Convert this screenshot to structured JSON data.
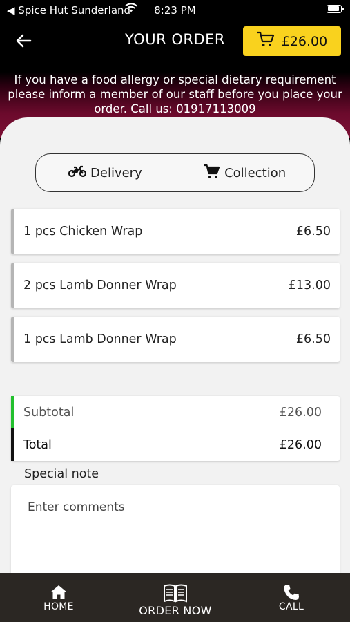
{
  "status_bar": {
    "back_app": "◀ Spice Hut Sunderland",
    "time": "8:23 PM"
  },
  "header": {
    "title": "YOUR ORDER",
    "cart_total": "£26.00",
    "allergy_notice": "If you have a food allergy or special dietary requirement please inform a member of our staff before you place your order. Call us: 01917113009"
  },
  "order_type": {
    "delivery_label": "Delivery",
    "collection_label": "Collection"
  },
  "items": [
    {
      "name": "1 pcs Chicken Wrap",
      "price": "£6.50"
    },
    {
      "name": "2 pcs Lamb Donner Wrap",
      "price": "£13.00"
    },
    {
      "name": "1 pcs Lamb Donner Wrap",
      "price": "£6.50"
    }
  ],
  "totals": {
    "subtotal_label": "Subtotal",
    "subtotal_value": "£26.00",
    "total_label": "Total",
    "total_value": "£26.00"
  },
  "special_note": {
    "label": "Special note",
    "placeholder": "Enter comments"
  },
  "tabbar": {
    "home_label": "HOME",
    "order_label": "ORDER NOW",
    "call_label": "CALL"
  },
  "colors": {
    "cart_button": "#f9d21e",
    "subtotal_accent": "#22c02e",
    "total_accent": "#111111",
    "header_gradient_end": "#7d1035",
    "tabbar_bg": "#2b2723"
  },
  "icons": [
    "back-arrow-icon",
    "cart-icon",
    "motorbike-icon",
    "home-icon",
    "book-icon",
    "phone-icon",
    "wifi-icon",
    "battery-icon"
  ]
}
